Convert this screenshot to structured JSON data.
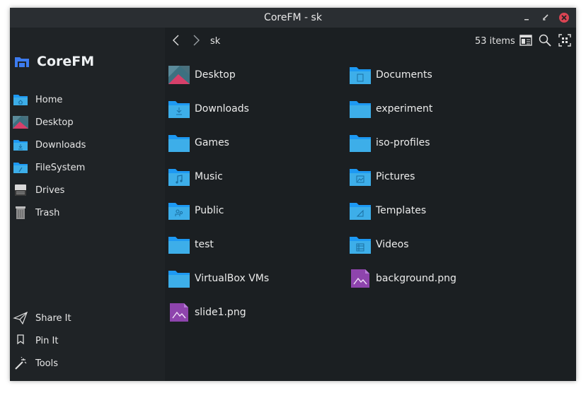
{
  "window": {
    "title": "CoreFM - sk"
  },
  "app": {
    "name": "CoreFM"
  },
  "sidebar": {
    "places": [
      {
        "label": "Home",
        "icon": "home-folder-icon"
      },
      {
        "label": "Desktop",
        "icon": "desktop-icon"
      },
      {
        "label": "Downloads",
        "icon": "downloads-folder-icon"
      },
      {
        "label": "FileSystem",
        "icon": "filesystem-folder-icon"
      },
      {
        "label": "Drives",
        "icon": "drive-icon"
      },
      {
        "label": "Trash",
        "icon": "trash-icon"
      }
    ],
    "actions": [
      {
        "label": "Share It",
        "icon": "share-icon"
      },
      {
        "label": "Pin It",
        "icon": "pin-icon"
      },
      {
        "label": "Tools",
        "icon": "tools-icon"
      }
    ]
  },
  "toolbar": {
    "path": "sk",
    "count": "53 items"
  },
  "files": [
    {
      "label": "Desktop",
      "icon": "desktop-icon"
    },
    {
      "label": "Documents",
      "icon": "documents-folder-icon"
    },
    {
      "label": "Downloads",
      "icon": "downloads-folder-icon"
    },
    {
      "label": "experiment",
      "icon": "folder-icon"
    },
    {
      "label": "Games",
      "icon": "folder-icon"
    },
    {
      "label": "iso-profiles",
      "icon": "folder-icon"
    },
    {
      "label": "Music",
      "icon": "music-folder-icon"
    },
    {
      "label": "Pictures",
      "icon": "pictures-folder-icon"
    },
    {
      "label": "Public",
      "icon": "public-folder-icon"
    },
    {
      "label": "Templates",
      "icon": "templates-folder-icon"
    },
    {
      "label": "test",
      "icon": "folder-icon"
    },
    {
      "label": "Videos",
      "icon": "videos-folder-icon"
    },
    {
      "label": "VirtualBox VMs",
      "icon": "folder-icon"
    },
    {
      "label": "background.png",
      "icon": "image-file-icon"
    },
    {
      "label": "slide1.png",
      "icon": "image-file-icon"
    }
  ],
  "colors": {
    "folder": "#3daee9",
    "folder_dark": "#1d99f3",
    "image_file": "#8e44ad",
    "close": "#da4453",
    "accent": "#3d7cf0"
  }
}
